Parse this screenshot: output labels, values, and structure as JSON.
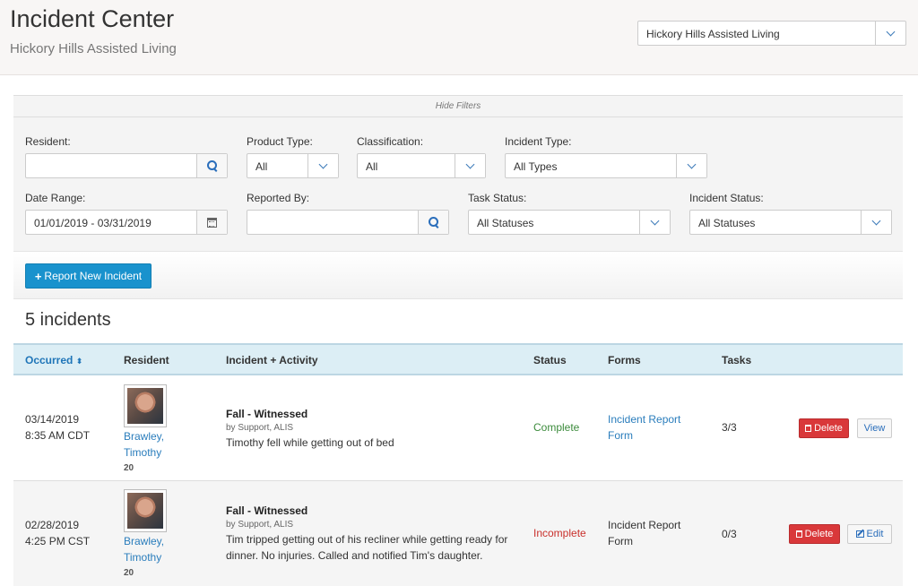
{
  "header": {
    "title": "Incident Center",
    "subtitle": "Hickory Hills Assisted Living",
    "facility_select": "Hickory Hills Assisted Living"
  },
  "filters": {
    "toggle_label": "Hide Filters",
    "resident": {
      "label": "Resident:",
      "value": ""
    },
    "product_type": {
      "label": "Product Type:",
      "value": "All"
    },
    "classification": {
      "label": "Classification:",
      "value": "All"
    },
    "incident_type": {
      "label": "Incident Type:",
      "value": "All Types"
    },
    "date_range": {
      "label": "Date Range:",
      "value": "01/01/2019 - 03/31/2019"
    },
    "reported_by": {
      "label": "Reported By:",
      "value": ""
    },
    "task_status": {
      "label": "Task Status:",
      "value": "All Statuses"
    },
    "incident_status": {
      "label": "Incident Status:",
      "value": "All Statuses"
    }
  },
  "actions": {
    "report_new": "Report New Incident"
  },
  "results": {
    "count_label": "5 incidents"
  },
  "table": {
    "columns": {
      "occurred": "Occurred",
      "resident": "Resident",
      "incident": "Incident + Activity",
      "status": "Status",
      "forms": "Forms",
      "tasks": "Tasks"
    },
    "rows": [
      {
        "date": "03/14/2019",
        "time": "8:35 AM CDT",
        "resident_last": "Brawley,",
        "resident_first": "Timothy",
        "resident_num": "20",
        "title": "Fall - Witnessed",
        "by": "by Support, ALIS",
        "desc_line1": "Timothy fell while getting out of bed",
        "desc_line2": "",
        "status": "Complete",
        "form_line1": "Incident Report",
        "form_line2": "Form",
        "tasks": "3/3",
        "delete_label": "Delete",
        "secondary_label": "View"
      },
      {
        "date": "02/28/2019",
        "time": "4:25 PM CST",
        "resident_last": "Brawley,",
        "resident_first": "Timothy",
        "resident_num": "20",
        "title": "Fall - Witnessed",
        "by": "by Support, ALIS",
        "desc_line1": "Tim tripped getting out of his recliner while getting ready for",
        "desc_line2": "dinner. No injuries. Called and notified Tim's daughter.",
        "status": "Incomplete",
        "form_line1": "Incident Report",
        "form_line2": "Form",
        "tasks": "0/3",
        "delete_label": "Delete",
        "secondary_label": "Edit"
      }
    ]
  },
  "colors": {
    "primary": "#1992cd",
    "danger": "#d9383a",
    "success": "#3c8b3c",
    "link": "#2a7dbc",
    "header_row": "#dceef5"
  },
  "icons": [
    "search-icon",
    "calendar-icon",
    "chevron-down-icon",
    "plus-icon",
    "sort-icon",
    "trash-icon",
    "edit-icon"
  ]
}
